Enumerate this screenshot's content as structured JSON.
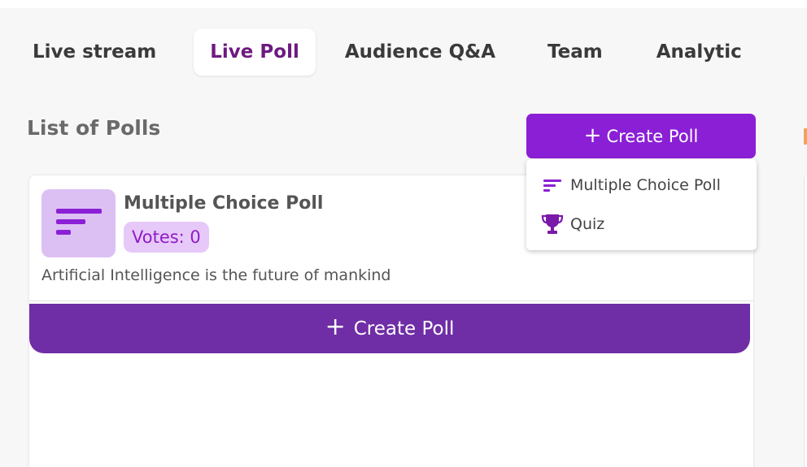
{
  "tabs": [
    {
      "label": "Live stream"
    },
    {
      "label": "Live Poll"
    },
    {
      "label": "Audience Q&A"
    },
    {
      "label": "Team"
    },
    {
      "label": "Analytic"
    }
  ],
  "active_tab": "Live Poll",
  "section": {
    "title": "List of Polls"
  },
  "create_button": {
    "icon": "+",
    "label": "Create Poll"
  },
  "dropdown": {
    "items": [
      {
        "icon": "sort-lines-icon",
        "label": "Multiple Choice Poll"
      },
      {
        "icon": "trophy-icon",
        "label": "Quiz"
      }
    ]
  },
  "poll_card": {
    "icon": "sort-lines-icon",
    "title": "Multiple Choice Poll",
    "votes": "Votes: 0",
    "question": "Artificial Intelligence is the future of mankind",
    "create_icon": "+",
    "create_label": "Create Poll"
  },
  "colors": {
    "accent_purple": "#8b1fd6",
    "dark_purple": "#6f2da6",
    "active_tab_text": "#6d1b7f",
    "icon_bg": "#dcbff3",
    "badge_bg": "#e6c9f8"
  }
}
